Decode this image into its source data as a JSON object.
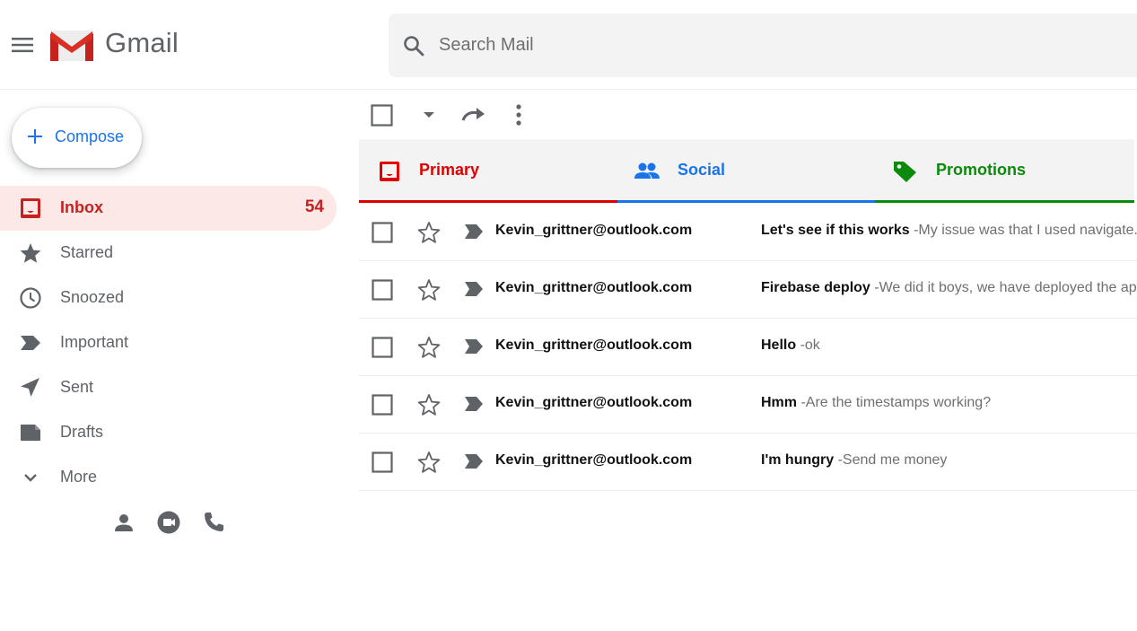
{
  "app": {
    "brand": "Gmail"
  },
  "search": {
    "placeholder": "Search Mail"
  },
  "compose": {
    "label": "Compose"
  },
  "sidebar": {
    "items": [
      {
        "label": "Inbox",
        "count": "54",
        "icon": "inbox-icon"
      },
      {
        "label": "Starred",
        "icon": "star-icon"
      },
      {
        "label": "Snoozed",
        "icon": "clock-icon"
      },
      {
        "label": "Important",
        "icon": "important-icon"
      },
      {
        "label": "Sent",
        "icon": "send-icon"
      },
      {
        "label": "Drafts",
        "icon": "draft-icon"
      },
      {
        "label": "More",
        "icon": "chevron-down-icon"
      }
    ],
    "footer_icons": [
      "person-icon",
      "video-icon",
      "phone-icon"
    ]
  },
  "tabs": [
    {
      "label": "Primary",
      "icon": "inbox-icon",
      "color": "#e00000"
    },
    {
      "label": "Social",
      "icon": "people-icon",
      "color": "#1a73e8"
    },
    {
      "label": "Promotions",
      "icon": "tag-icon",
      "color": "#0b8a0b"
    }
  ],
  "separator": "-",
  "emails": [
    {
      "sender": "Kevin_grittner@outlook.com",
      "subject": "Let's see if this works",
      "snippet": "My issue was that I used navigate.push"
    },
    {
      "sender": "Kevin_grittner@outlook.com",
      "subject": "Firebase deploy",
      "snippet": "We did it boys, we have deployed the app"
    },
    {
      "sender": "Kevin_grittner@outlook.com",
      "subject": "Hello",
      "snippet": "ok"
    },
    {
      "sender": "Kevin_grittner@outlook.com",
      "subject": "Hmm",
      "snippet": "Are the timestamps working?"
    },
    {
      "sender": "Kevin_grittner@outlook.com",
      "subject": "I'm hungry",
      "snippet": "Send me money"
    }
  ],
  "colors": {
    "active_bg": "#fce8e6",
    "active_text": "#c5221f",
    "compose_text": "#1a73e8",
    "icon_gray": "#5f6368"
  }
}
